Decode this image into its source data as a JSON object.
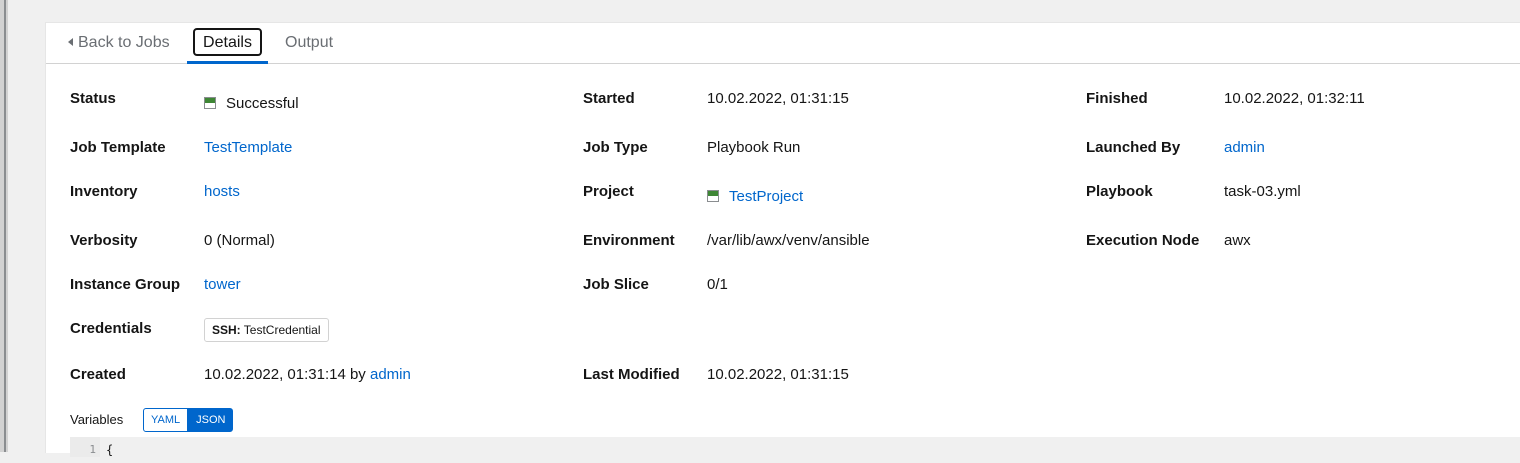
{
  "tabs": {
    "back_label": "Back to Jobs",
    "details_label": "Details",
    "output_label": "Output"
  },
  "details": {
    "status": {
      "label": "Status",
      "value": "Successful"
    },
    "started": {
      "label": "Started",
      "value": "10.02.2022, 01:31:15"
    },
    "finished": {
      "label": "Finished",
      "value": "10.02.2022, 01:32:11"
    },
    "job_template": {
      "label": "Job Template",
      "value": "TestTemplate"
    },
    "job_type": {
      "label": "Job Type",
      "value": "Playbook Run"
    },
    "launched_by": {
      "label": "Launched By",
      "value": "admin"
    },
    "inventory": {
      "label": "Inventory",
      "value": "hosts"
    },
    "project": {
      "label": "Project",
      "value": "TestProject"
    },
    "playbook": {
      "label": "Playbook",
      "value": "task-03.yml"
    },
    "verbosity": {
      "label": "Verbosity",
      "value": "0 (Normal)"
    },
    "environment": {
      "label": "Environment",
      "value": "/var/lib/awx/venv/ansible"
    },
    "execution_node": {
      "label": "Execution Node",
      "value": "awx"
    },
    "instance_group": {
      "label": "Instance Group",
      "value": "tower"
    },
    "job_slice": {
      "label": "Job Slice",
      "value": "0/1"
    },
    "credentials": {
      "label": "Credentials",
      "chip_type": "SSH:",
      "chip_name": "TestCredential"
    },
    "created": {
      "label": "Created",
      "value": "10.02.2022, 01:31:14",
      "by": "by",
      "user": "admin"
    },
    "last_modified": {
      "label": "Last Modified",
      "value": "10.02.2022, 01:31:15"
    }
  },
  "variables": {
    "label": "Variables",
    "yaml_label": "YAML",
    "json_label": "JSON",
    "selected": "JSON",
    "line_number": "1",
    "first_line": "{"
  },
  "colors": {
    "link": "#0066cc",
    "success": "#3e8635",
    "accent": "#0066cc"
  }
}
